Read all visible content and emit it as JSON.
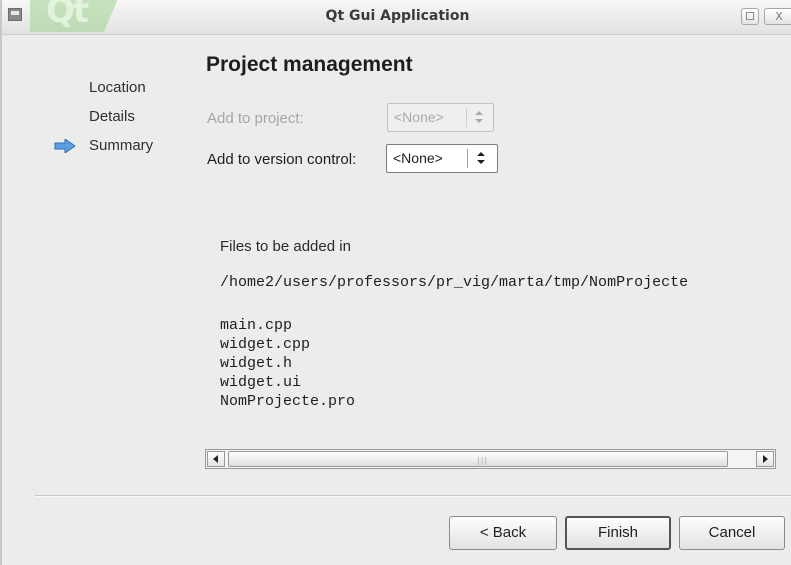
{
  "window": {
    "title": "Qt Gui Application",
    "logo_text": "Qt",
    "close_glyph": "X"
  },
  "sidebar": {
    "items": [
      {
        "label": "Location",
        "current": false
      },
      {
        "label": "Details",
        "current": false
      },
      {
        "label": "Summary",
        "current": true
      }
    ]
  },
  "page": {
    "title": "Project management",
    "add_to_project": {
      "label": "Add to project:",
      "value": "<None>",
      "enabled": false
    },
    "version_control": {
      "label": "Add to version control:",
      "value": "<None>",
      "enabled": true
    },
    "files_label": "Files to be added in",
    "path": "/home2/users/professors/pr_vig/marta/tmp/NomProjecte",
    "files": [
      "main.cpp",
      "widget.cpp",
      "widget.h",
      "widget.ui",
      "NomProjecte.pro"
    ],
    "scroll_grip": "|||"
  },
  "buttons": {
    "back": "< Back",
    "finish": "Finish",
    "cancel": "Cancel"
  },
  "colors": {
    "arrow_icon": "#5aa0e0",
    "logo_green": "#9ed48e"
  }
}
